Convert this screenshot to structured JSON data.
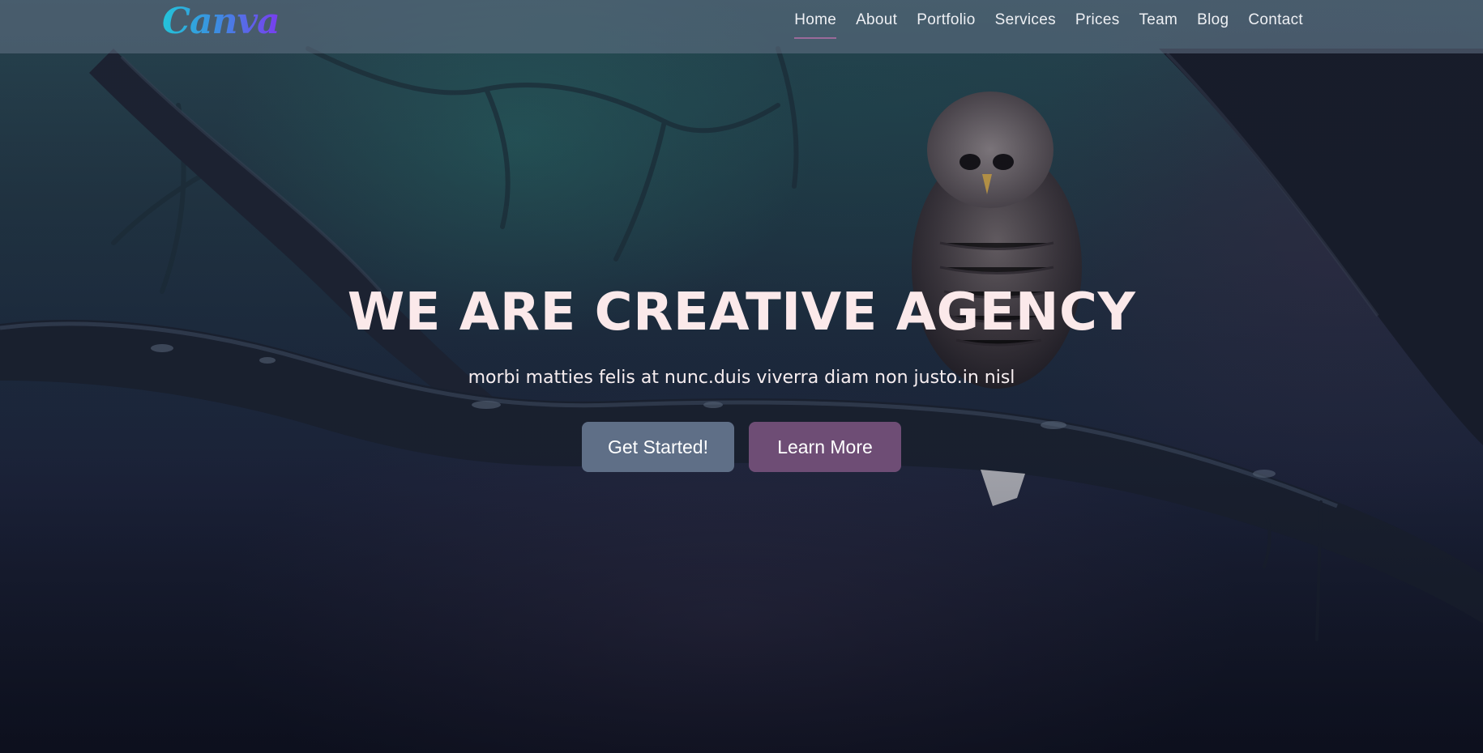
{
  "header": {
    "logo_text": "Canva",
    "nav": [
      {
        "label": "Home",
        "active": true
      },
      {
        "label": "About"
      },
      {
        "label": "Portfolio"
      },
      {
        "label": "Services"
      },
      {
        "label": "Prices"
      },
      {
        "label": "Team"
      },
      {
        "label": "Blog"
      },
      {
        "label": "Contact"
      }
    ]
  },
  "hero": {
    "title": "WE ARE CREATIVE AGENCY",
    "subtitle": "morbi matties felis at nunc.duis viverra diam non justo.in nisl",
    "primary_button": "Get Started!",
    "secondary_button": "Learn More",
    "background_image": "owl-on-branch-night-forest"
  },
  "colors": {
    "header_bg": "#647387",
    "nav_text": "#eef0f4",
    "active_underline": "#9b6a9a",
    "title_text": "#fbe9ea",
    "primary_button": "#5f6f87",
    "secondary_button": "#6e4d75",
    "logo_gradient_start": "#23c4d9",
    "logo_gradient_end": "#7a3cf0"
  }
}
